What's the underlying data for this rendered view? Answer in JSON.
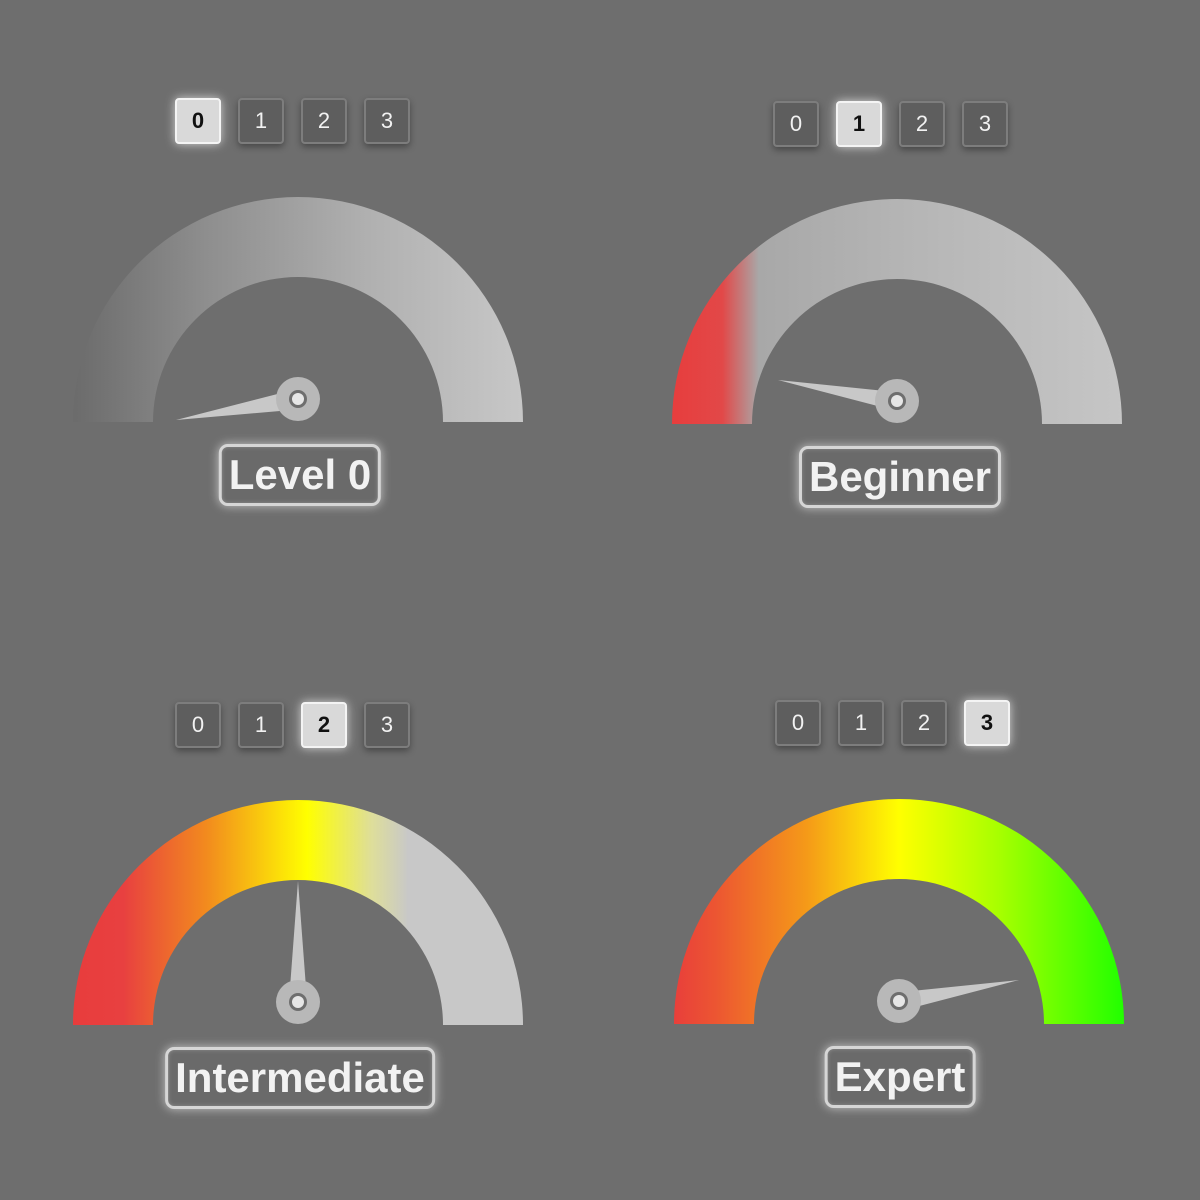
{
  "level_buttons": [
    "0",
    "1",
    "2",
    "3"
  ],
  "gauges": [
    {
      "caption": "Level 0",
      "selected": 0,
      "needle_level": 0.1
    },
    {
      "caption": "Beginner",
      "selected": 1,
      "needle_level": 0.06
    },
    {
      "caption": "Intermediate",
      "selected": 2,
      "needle_level": 0.52
    },
    {
      "caption": "Expert",
      "selected": 3,
      "needle_level": 0.96
    }
  ],
  "colors": {
    "background": "#6e6e6e",
    "track": "#c8c8c8",
    "red": "#e83c3c",
    "orange": "#f28a1e",
    "yellow": "#ffff00",
    "green": "#22ff00",
    "hub": "#b8b8b8"
  }
}
